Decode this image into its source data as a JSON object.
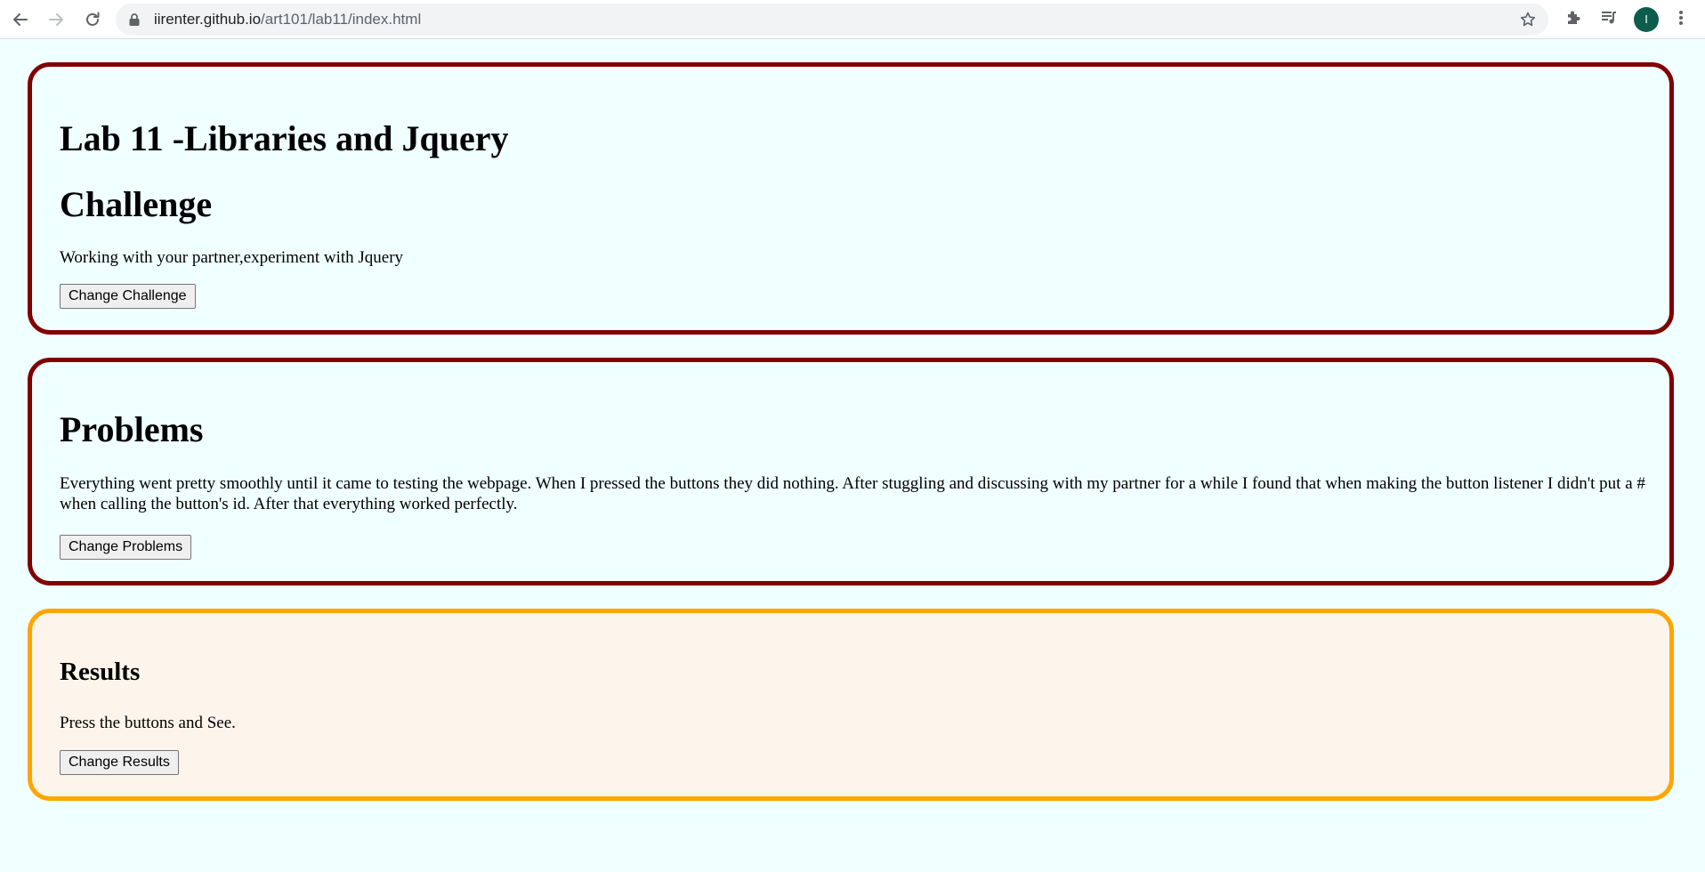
{
  "browser": {
    "url_host": "iirenter.github.io",
    "url_path": "/art101/lab11/index.html",
    "avatar_letter": "I",
    "icons": [
      "back-arrow-icon",
      "forward-arrow-icon",
      "reload-icon",
      "lock-icon",
      "star-icon",
      "extensions-icon",
      "media-control-icon",
      "more-menu-icon"
    ],
    "avatar_color": "#0b5e4b"
  },
  "page": {
    "background_color": "#f0ffff",
    "challenge": {
      "title": "Lab 11 -Libraries and Jquery",
      "heading": "Challenge",
      "text": "Working with your partner,experiment with Jquery",
      "button_label": "Change Challenge",
      "border_color": "#800000"
    },
    "problems": {
      "heading": "Problems",
      "text": "Everything went pretty smoothly until it came to testing the webpage. When I pressed the buttons they did nothing. After stuggling and discussing with my partner for a while I found that when making the button listener I didn't put a # when calling the button's id. After that everything worked perfectly.",
      "button_label": "Change Problems",
      "border_color": "#800000"
    },
    "results": {
      "heading": "Results",
      "text": "Press the buttons and See.",
      "button_label": "Change Results",
      "border_color": "#ffa500",
      "background_color": "#fdf5eb"
    }
  }
}
